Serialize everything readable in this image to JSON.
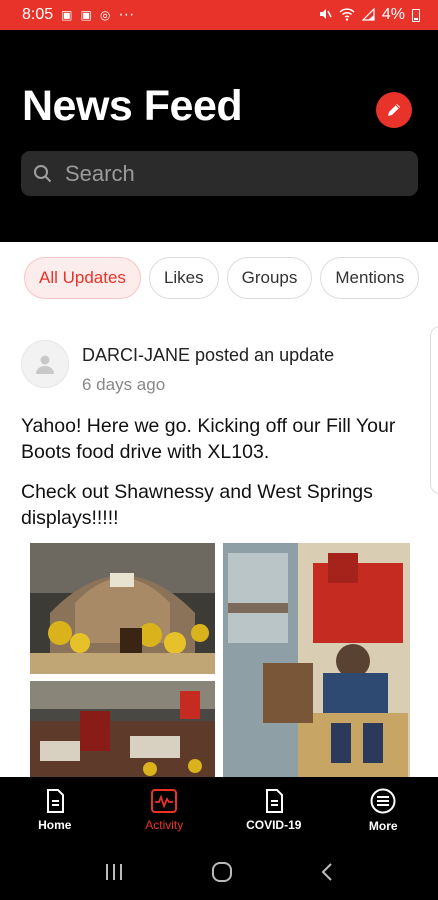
{
  "status_bar": {
    "time": "8:05",
    "more_indicator": "···",
    "battery_percent": "4%",
    "left_icons": [
      "teams-icon",
      "teams-icon",
      "messenger-icon"
    ],
    "right_icons": [
      "mute-icon",
      "wifi-icon",
      "signal-icon",
      "battery-icon"
    ]
  },
  "header": {
    "title": "News Feed",
    "compose_icon": "pencil-icon"
  },
  "search": {
    "placeholder": "Search"
  },
  "filters": [
    {
      "label": "All Updates",
      "active": true
    },
    {
      "label": "Likes",
      "active": false
    },
    {
      "label": "Groups",
      "active": false
    },
    {
      "label": "Mentions",
      "active": false
    }
  ],
  "post": {
    "author_line": "DARCI-JANE posted an update",
    "time": "6 days ago",
    "paragraphs": [
      "Yahoo! Here we go. Kicking off our Fill Your Boots food drive with XL103.",
      "Check out Shawnessy and West Springs displays!!!!!"
    ]
  },
  "tabs": [
    {
      "label": "Home",
      "icon": "document-icon",
      "active": false
    },
    {
      "label": "Activity",
      "icon": "activity-icon",
      "active": true
    },
    {
      "label": "COVID-19",
      "icon": "document-icon",
      "active": false
    },
    {
      "label": "More",
      "icon": "menu-icon",
      "active": false
    }
  ],
  "nav_bar": [
    "recents-icon",
    "home-icon",
    "back-icon"
  ],
  "colors": {
    "accent": "#e8332a",
    "header_bg": "#000000",
    "chip_active_bg": "#fdecec"
  }
}
